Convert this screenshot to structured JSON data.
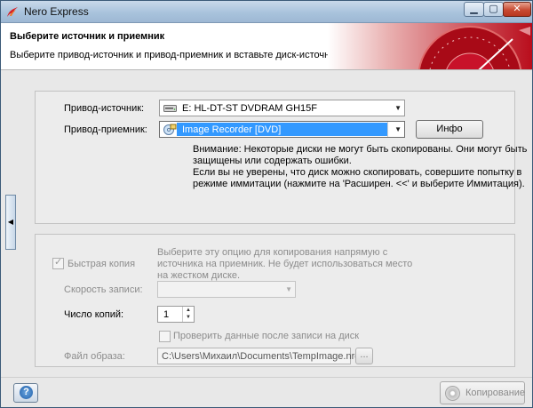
{
  "window": {
    "title": "Nero Express",
    "minimize": "▁",
    "maximize": "▢",
    "close": "✕"
  },
  "header": {
    "title": "Выберите источник и приемник",
    "subtitle": "Выберите привод-источник и привод-приемник и вставьте диск-источник."
  },
  "source": {
    "label": "Привод-источник:",
    "value": "E: HL-DT-ST DVDRAM GH15F"
  },
  "target": {
    "label": "Привод-приемник:",
    "value": "Image Recorder   [DVD]",
    "info_button": "Инфо"
  },
  "notes": {
    "warning": "Внимание: Некоторые диски не могут быть скопированы. Они могут быть защищены или содержать ошибки.",
    "hint": "Если вы не уверены, что диск можно скопировать, совершите попытку в режиме иммитации (нажмите на 'Расширен. <<' и выберите Иммитация)."
  },
  "options": {
    "quick_copy_label": "Быстрая копия",
    "quick_copy_checked": true,
    "quick_copy_desc": "Выберите эту опцию для копирования напрямую с источника на приемник. Не будет использоваться место на жестком диске.",
    "speed_label": "Скорость записи:",
    "speed_value": "",
    "copies_label": "Число копий:",
    "copies_value": "1",
    "verify_label": "Проверить данные после записи на диск",
    "verify_checked": false,
    "image_file_label": "Файл образа:",
    "image_file_path": "C:\\Users\\Михаил\\Documents\\TempImage.nrg",
    "browse_button": "..."
  },
  "footer": {
    "help": "?",
    "copy_button": "Копирование"
  },
  "side_toggle": "◀",
  "colors": {
    "selection": "#3399ff",
    "accent_red": "#c8102e",
    "disabled_text": "#8c8c8c"
  }
}
